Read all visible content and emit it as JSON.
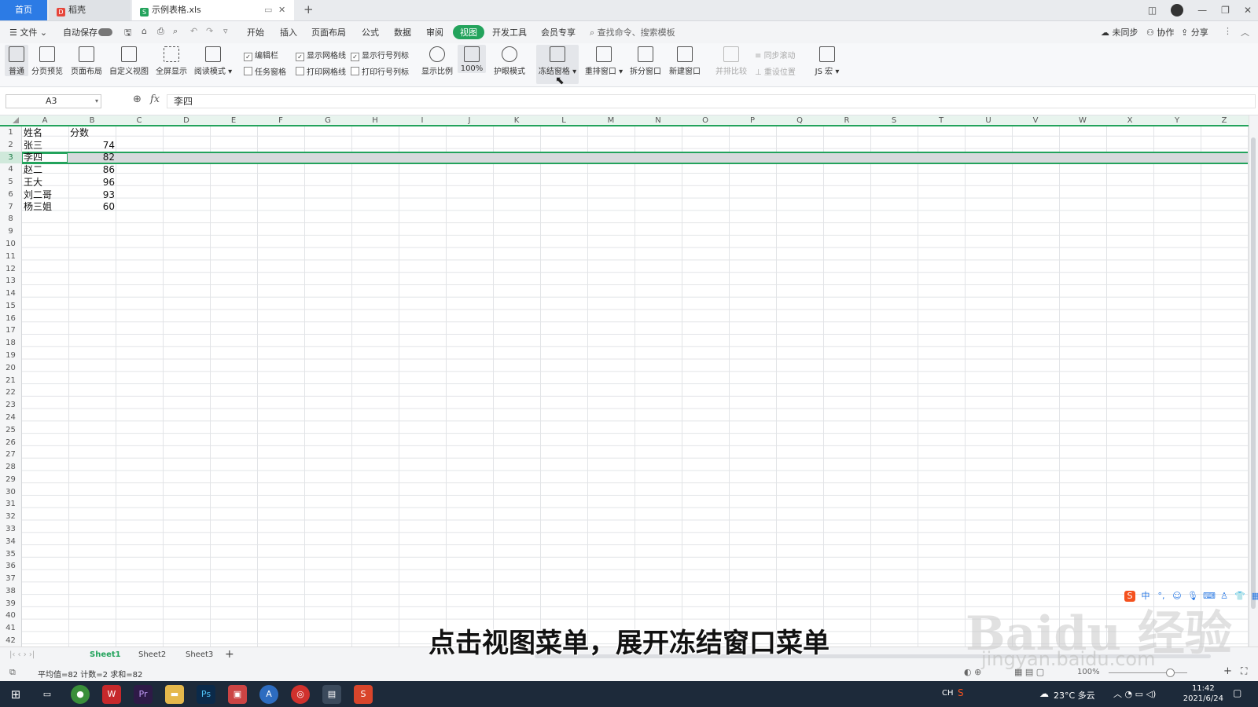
{
  "tabs": {
    "home": "首页",
    "wps": "稻壳",
    "file": "示例表格.xls",
    "new_tab": "+"
  },
  "menu": {
    "file": "文件",
    "autosave": "自动保存",
    "start": "开始",
    "insert": "插入",
    "page_layout": "页面布局",
    "formula": "公式",
    "data": "数据",
    "review": "审阅",
    "view": "视图",
    "dev_tools": "开发工具",
    "member": "会员专享",
    "search": "查找命令、搜索模板",
    "unsynced": "未同步",
    "collab": "协作",
    "share": "分享"
  },
  "ribbon": {
    "normal": "普通",
    "page_break": "分页预览",
    "page_layout": "页面布局",
    "custom_view": "自定义视图",
    "fullscreen": "全屏显示",
    "reading_mode": "阅读模式",
    "edit_bar": "编辑栏",
    "show_grid": "显示网格线",
    "show_headers": "显示行号列标",
    "task_pane": "任务窗格",
    "print_grid": "打印网格线",
    "print_headers": "打印行号列标",
    "zoom": "显示比例",
    "zoom_100": "100%",
    "eye_mode": "护眼模式",
    "freeze": "冻结窗格",
    "arrange": "重排窗口",
    "split": "拆分窗口",
    "new_window": "新建窗口",
    "side_by_side": "并排比较",
    "sync_scroll": "同步滚动",
    "reset_pos": "重设位置",
    "macro": "JS 宏"
  },
  "formula_bar": {
    "cell_ref": "A3",
    "fx": "fx",
    "value": "李四"
  },
  "columns": [
    "A",
    "B",
    "C",
    "D",
    "E",
    "F",
    "G",
    "H",
    "I",
    "J",
    "K",
    "L",
    "M",
    "N",
    "O",
    "P",
    "Q",
    "R",
    "S",
    "T",
    "U",
    "V",
    "W",
    "X",
    "Y",
    "Z"
  ],
  "rows": [
    "1",
    "2",
    "3",
    "4",
    "5",
    "6",
    "7",
    "8",
    "9",
    "10",
    "11",
    "12",
    "13",
    "14",
    "15",
    "16",
    "17",
    "18",
    "19",
    "20",
    "21",
    "22",
    "23",
    "24",
    "25",
    "26",
    "27",
    "28",
    "29",
    "30",
    "31",
    "32",
    "33",
    "34",
    "35",
    "36",
    "37",
    "38",
    "39",
    "40",
    "41",
    "42"
  ],
  "cells": {
    "a1": "姓名",
    "b1": "分数",
    "a2": "张三",
    "b2": "74",
    "a3": "李四",
    "b3": "82",
    "a4": "赵二",
    "b4": "86",
    "a5": "王大",
    "b5": "96",
    "a6": "刘二哥",
    "b6": "93",
    "a7": "杨三姐",
    "b7": "60"
  },
  "sheets": [
    "Sheet1",
    "Sheet2",
    "Sheet3"
  ],
  "add_sheet": "+",
  "status": {
    "summary": "平均值=82  计数=2  求和=82",
    "zoom": "100%"
  },
  "taskbar": {
    "ime": "CH",
    "weather": "23°C 多云",
    "time": "11:42",
    "date": "2021/6/24"
  },
  "overlay": {
    "subtitle": "点击视图菜单，展开冻结窗口菜单",
    "watermark": "Baidu 经验",
    "watermark_url": "jingyan.baidu.com",
    "ime_cn": "中"
  },
  "colors": {
    "accent": "#23a35c",
    "tab_blue": "#2c7be5",
    "taskbar": "#1d2a3a"
  }
}
